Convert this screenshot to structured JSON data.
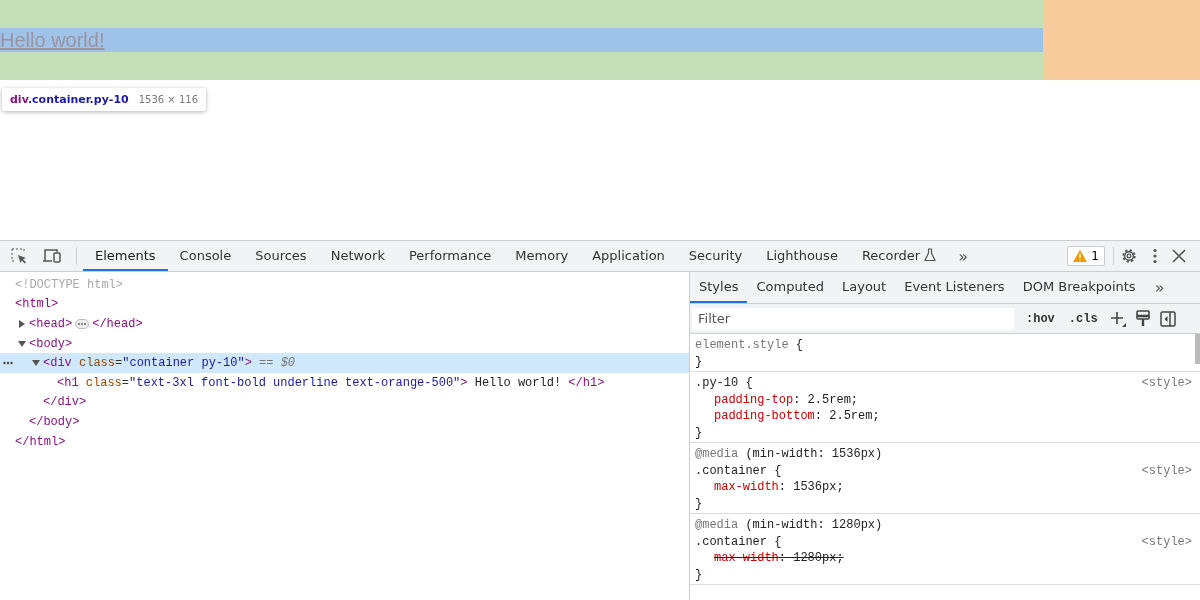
{
  "preview": {
    "heading": "Hello world!",
    "tooltip": {
      "tag": "div",
      "classes": ".container.py-10",
      "size": "1536 × 116"
    }
  },
  "toolbar": {
    "tabs": [
      {
        "label": "Elements",
        "selected": true
      },
      {
        "label": "Console",
        "selected": false
      },
      {
        "label": "Sources",
        "selected": false
      },
      {
        "label": "Network",
        "selected": false
      },
      {
        "label": "Performance",
        "selected": false
      },
      {
        "label": "Memory",
        "selected": false
      },
      {
        "label": "Application",
        "selected": false
      },
      {
        "label": "Security",
        "selected": false
      },
      {
        "label": "Lighthouse",
        "selected": false
      },
      {
        "label": "Recorder",
        "selected": false,
        "experimental": true
      }
    ],
    "more": "»",
    "warnings": "1"
  },
  "dom": [
    {
      "parts": [
        {
          "kind": "doctype",
          "text": "<!DOCTYPE html>"
        }
      ],
      "selected": false
    },
    {
      "parts": [
        {
          "kind": "tag",
          "text": "<html>"
        }
      ],
      "selected": false,
      "close": "</html>",
      "children": [
        {
          "parts": [
            {
              "kind": "tag",
              "text": "<head>"
            },
            {
              "kind": "ellipsis"
            },
            {
              "kind": "tag",
              "text": "</head>"
            }
          ],
          "expanded": false,
          "selected": false
        },
        {
          "parts": [
            {
              "kind": "tag",
              "text": "<body>"
            }
          ],
          "expanded": true,
          "selected": false,
          "close": "</body>",
          "children": [
            {
              "parts": [
                {
                  "kind": "tag",
                  "text": "<div"
                },
                {
                  "kind": "attr",
                  "text": " class"
                },
                {
                  "kind": "punct",
                  "text": "="
                },
                {
                  "kind": "value",
                  "text": "\"container py-10\""
                },
                {
                  "kind": "tag",
                  "text": ">"
                },
                {
                  "kind": "ref",
                  "text": " == $0"
                }
              ],
              "expanded": true,
              "selected": true,
              "close": "</div>",
              "children": [
                {
                  "parts": [
                    {
                      "kind": "tag",
                      "text": "<h1"
                    },
                    {
                      "kind": "attr",
                      "text": " class"
                    },
                    {
                      "kind": "punct",
                      "text": "="
                    },
                    {
                      "kind": "value",
                      "text": "\"text-3xl font-bold underline text-orange-500\""
                    },
                    {
                      "kind": "tag",
                      "text": ">"
                    },
                    {
                      "kind": "text",
                      "text": " Hello world! "
                    },
                    {
                      "kind": "tag",
                      "text": "</h1>"
                    }
                  ],
                  "selected": false
                }
              ]
            }
          ]
        }
      ]
    }
  ],
  "styles": {
    "tabs": [
      {
        "label": "Styles",
        "selected": true
      },
      {
        "label": "Computed",
        "selected": false
      },
      {
        "label": "Layout",
        "selected": false
      },
      {
        "label": "Event Listeners",
        "selected": false
      },
      {
        "label": "DOM Breakpoints",
        "selected": false
      }
    ],
    "more": "»",
    "filter_placeholder": "Filter",
    "hov": ":hov",
    "cls": ".cls",
    "rules": [
      {
        "selector": "element.style",
        "inline": true,
        "open": "{",
        "close": "}"
      },
      {
        "selector": ".py-10",
        "open": "{",
        "close": "}",
        "source": "<style>",
        "declarations": [
          {
            "property": "padding-top",
            "rest": ": 2.5rem;",
            "overridden": false
          },
          {
            "property": "padding-bottom",
            "rest": ": 2.5rem;",
            "overridden": false
          }
        ]
      },
      {
        "media_keyword": "@media",
        "media_query": "(min-width: 1536px)",
        "selector": ".container",
        "open": "{",
        "close": "}",
        "source": "<style>",
        "declarations": [
          {
            "property": "max-width",
            "rest": ": 1536px;",
            "overridden": false
          }
        ]
      },
      {
        "media_keyword": "@media",
        "media_query": "(min-width: 1280px)",
        "selector": ".container",
        "open": "{",
        "close": "}",
        "source": "<style>",
        "declarations": [
          {
            "property": "max-width",
            "rest": ": 1280px;",
            "overridden": true
          }
        ]
      }
    ]
  }
}
